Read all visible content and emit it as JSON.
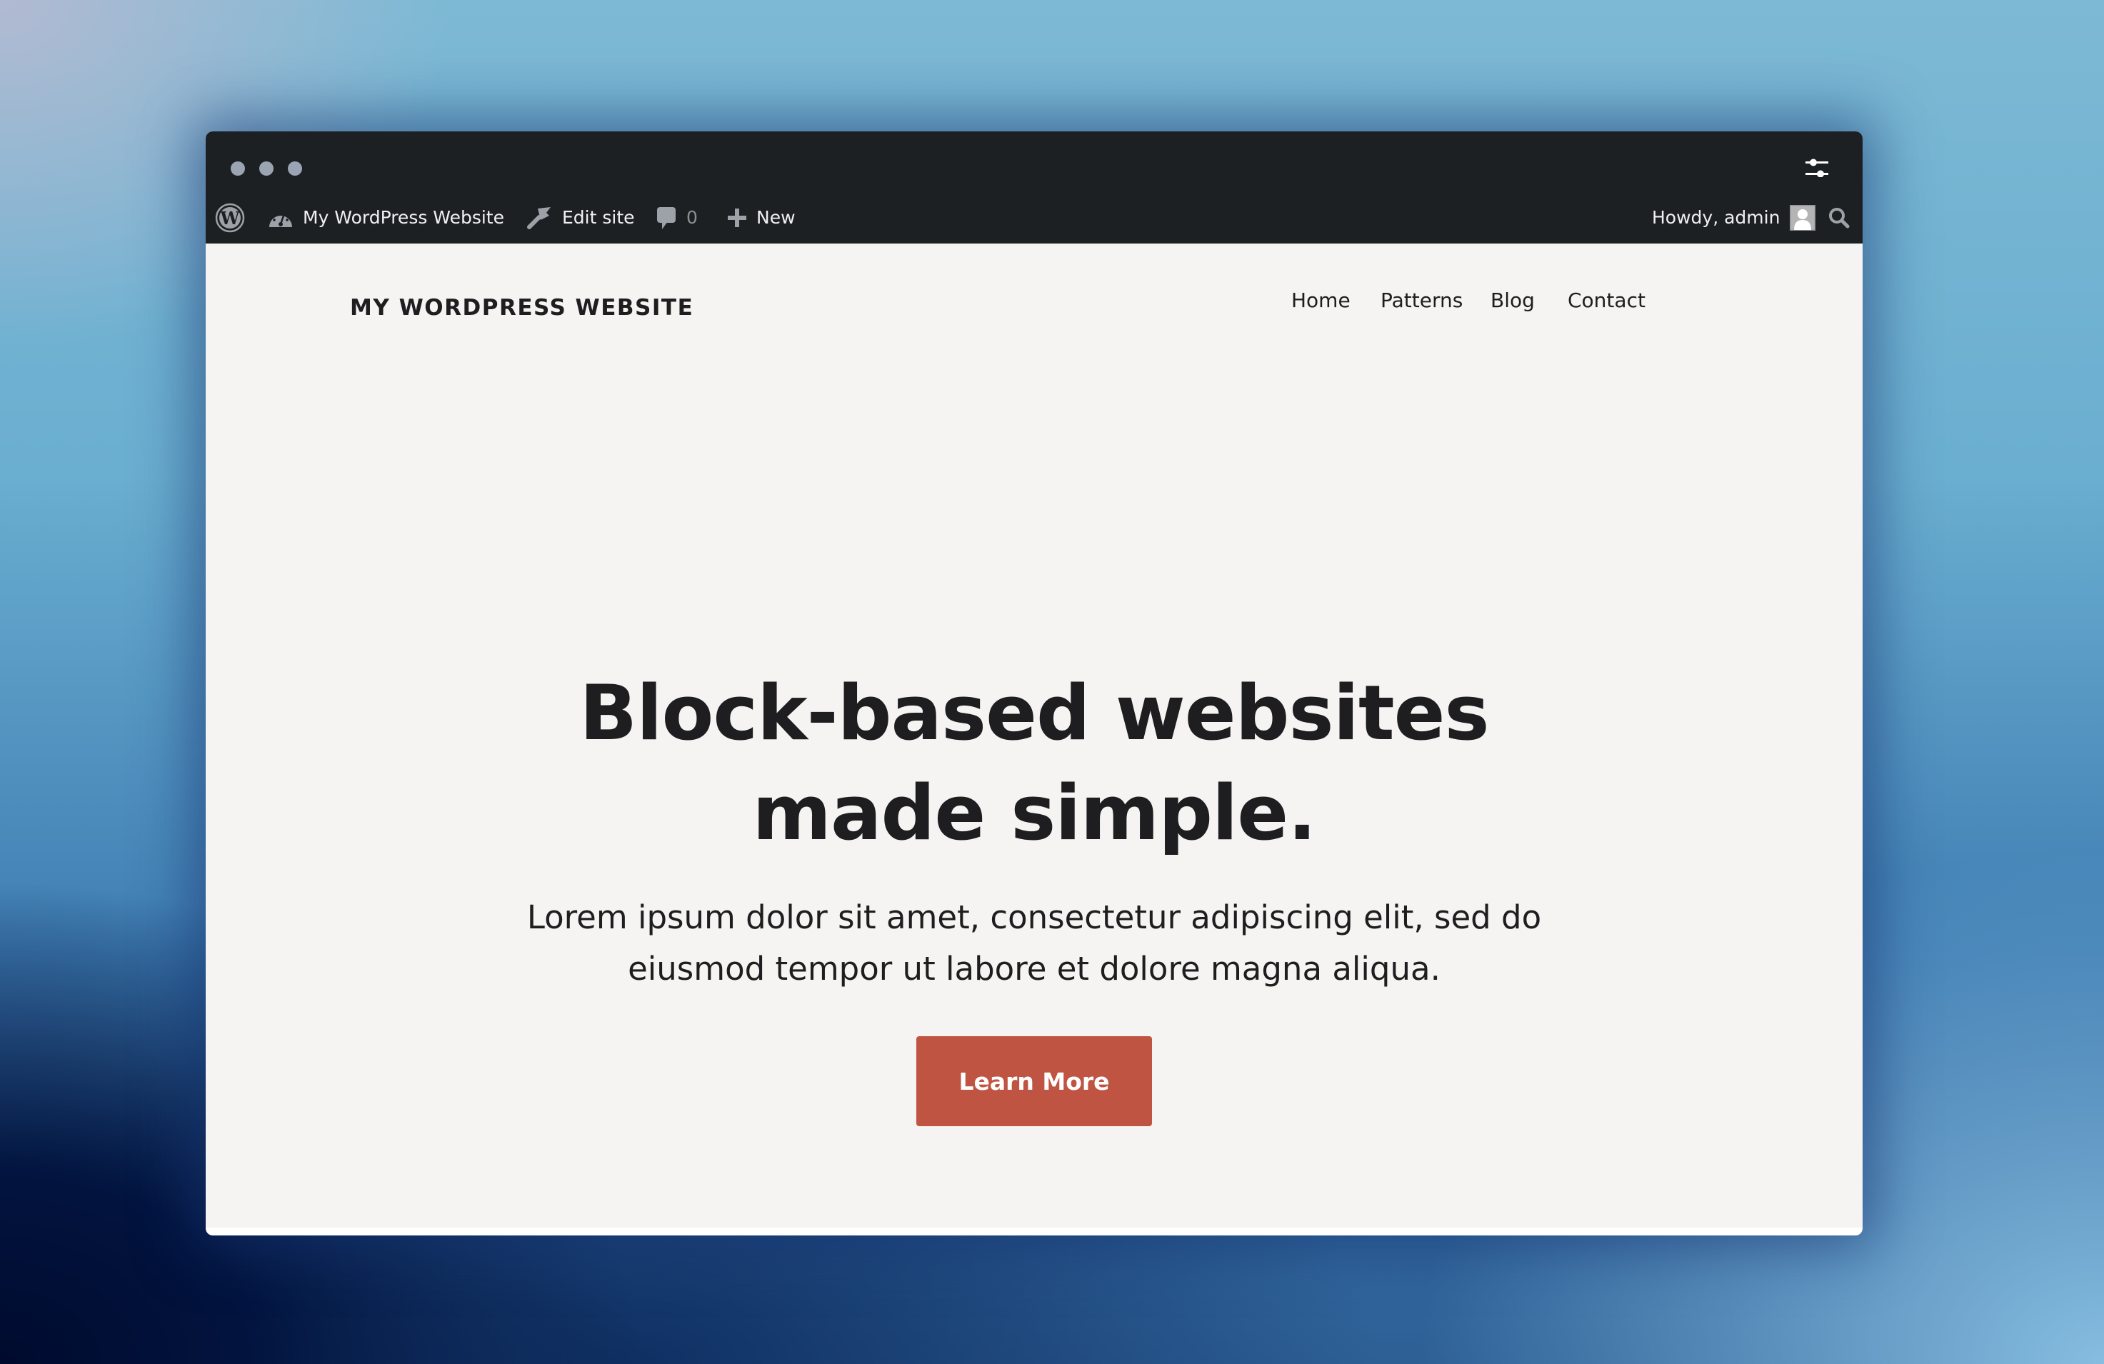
{
  "window": {
    "controls": [
      "window-dot",
      "window-dot",
      "window-dot"
    ],
    "settings_icon": "sliders-icon"
  },
  "admin_bar": {
    "wp_logo_icon": "wordpress-logo-icon",
    "site_name": "My WordPress Website",
    "site_icon": "dashboard-gauge-icon",
    "edit_site": "Edit site",
    "edit_icon": "brush-icon",
    "comments_count": "0",
    "comments_icon": "comment-bubble-icon",
    "new_label": "New",
    "new_icon": "plus-icon",
    "greeting": "Howdy, admin",
    "avatar_icon": "user-avatar-icon",
    "search_icon": "search-icon"
  },
  "site": {
    "title": "My WordPress Website",
    "nav": [
      {
        "label": "Home"
      },
      {
        "label": "Patterns"
      },
      {
        "label": "Blog"
      },
      {
        "label": "Contact"
      }
    ]
  },
  "hero": {
    "heading_line1": "Block-based websites",
    "heading_line2": "made simple.",
    "text_line1": "Lorem ipsum dolor sit amet, consectetur adipiscing elit, sed do",
    "text_line2": "eiusmod tempor ut labore et dolore magna aliqua.",
    "button_label": "Learn More"
  },
  "colors": {
    "admin_bar_bg": "#1d2023",
    "page_bg": "#f5f4f2",
    "text": "#1e1e20",
    "accent_button": "#c05442"
  }
}
